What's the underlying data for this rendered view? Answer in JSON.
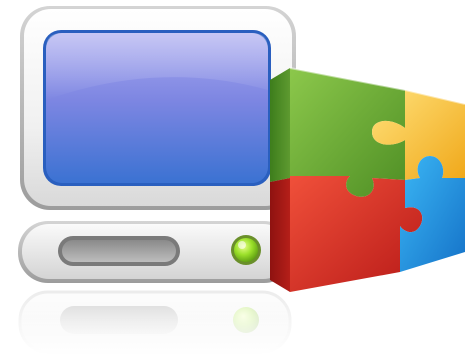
{
  "illustration": {
    "subject": "computer-with-puzzle-box-icon",
    "colors": {
      "screen_top": "#a6a9ef",
      "screen_mid": "#6a80e0",
      "screen_bottom": "#3a6fd0",
      "casing_light": "#ffffff",
      "casing_dark": "#b8b8b8",
      "power_led": "#9be02a",
      "puzzle_green": "#6db33f",
      "puzzle_yellow": "#f2c12e",
      "puzzle_red": "#e0312a",
      "puzzle_blue": "#1f9be6"
    }
  }
}
